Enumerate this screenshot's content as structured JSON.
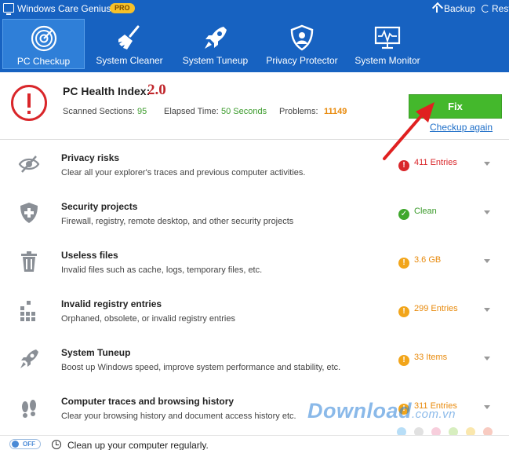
{
  "app": {
    "title": "Windows Care Genius",
    "badge": "PRO",
    "backup": "Backup",
    "restore": "Rest"
  },
  "nav": [
    {
      "label": "PC Checkup",
      "icon": "radar-icon"
    },
    {
      "label": "System Cleaner",
      "icon": "broom-icon"
    },
    {
      "label": "System Tuneup",
      "icon": "rocket-icon"
    },
    {
      "label": "Privacy Protector",
      "icon": "shield-icon"
    },
    {
      "label": "System Monitor",
      "icon": "monitor-pulse-icon"
    }
  ],
  "health": {
    "title": "PC Health Index:",
    "score": "2.0",
    "scanned_label": "Scanned Sections:",
    "scanned_value": "95",
    "elapsed_label": "Elapsed Time:",
    "elapsed_value": "50 Seconds",
    "problems_label": "Problems:",
    "problems_value": "11149",
    "fix": "Fix",
    "checkup_again": "Checkup again"
  },
  "items": [
    {
      "title": "Privacy risks",
      "desc": "Clear all your explorer's traces and previous computer activities.",
      "status": "411 Entries",
      "level": "red",
      "icon": "eye-slash-icon"
    },
    {
      "title": "Security projects",
      "desc": "Firewall, registry, remote desktop, and other security projects",
      "status": "Clean",
      "level": "green",
      "icon": "shield-plus-icon"
    },
    {
      "title": "Useless files",
      "desc": "Invalid files such as cache, logs, temporary files, etc.",
      "status": "3.6 GB",
      "level": "orange",
      "icon": "trash-icon"
    },
    {
      "title": "Invalid registry entries",
      "desc": "Orphaned, obsolete, or invalid registry entries",
      "status": "299 Entries",
      "level": "orange",
      "icon": "registry-blocks-icon"
    },
    {
      "title": "System Tuneup",
      "desc": "Boost up Windows speed, improve system performance and stability, etc.",
      "status": "33 Items",
      "level": "orange",
      "icon": "rocket-icon"
    },
    {
      "title": "Computer traces and browsing history",
      "desc": "Clear your browsing history and document access history etc.",
      "status": "311 Entries",
      "level": "orange",
      "icon": "footprints-icon"
    }
  ],
  "footer": {
    "toggle": "OFF",
    "text": "Clean up your computer regularly."
  },
  "watermark": {
    "brand": "Download",
    "suffix": ".com.vn"
  },
  "colors": {
    "header": "#1762c1",
    "fix": "#44b82c",
    "danger": "#d9262a",
    "warning": "#f2a51a",
    "ok": "#3fa72c"
  }
}
